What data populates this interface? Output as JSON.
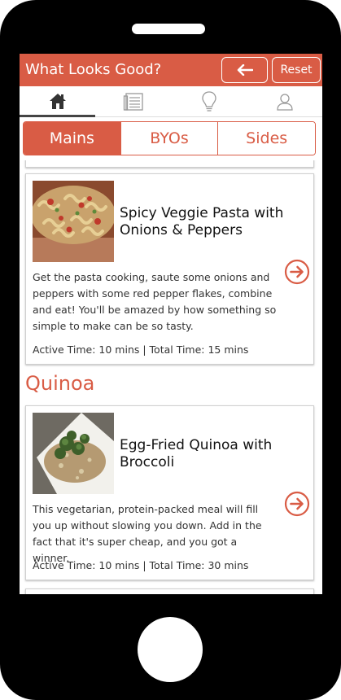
{
  "header": {
    "title": "What Looks Good?",
    "reset_label": "Reset",
    "accent_color": "#d95c45"
  },
  "nav": {
    "items": [
      {
        "icon": "home-icon",
        "active": true
      },
      {
        "icon": "document-icon",
        "active": false
      },
      {
        "icon": "lightbulb-icon",
        "active": false
      },
      {
        "icon": "user-icon",
        "active": false
      }
    ]
  },
  "tabs": [
    {
      "label": "Mains",
      "active": true
    },
    {
      "label": "BYOs",
      "active": false
    },
    {
      "label": "Sides",
      "active": false
    }
  ],
  "recipes": [
    {
      "title": "Spicy Veggie Pasta with Onions & Peppers",
      "description": "Get the pasta cooking, saute some onions and peppers with some red pepper flakes, combine and eat! You'll be amazed by how something so simple to make can be so tasty.",
      "meta": "Active Time: 10 mins | Total Time: 15 mins"
    },
    {
      "section": "Quinoa",
      "title": "Egg-Fried Quinoa with Broccoli",
      "description": "This vegetarian, protein-packed meal will fill you up without slowing you down. Add in the fact that it's super cheap, and you got a winner.",
      "meta": "Active Time: 10 mins | Total Time: 30 mins"
    }
  ]
}
